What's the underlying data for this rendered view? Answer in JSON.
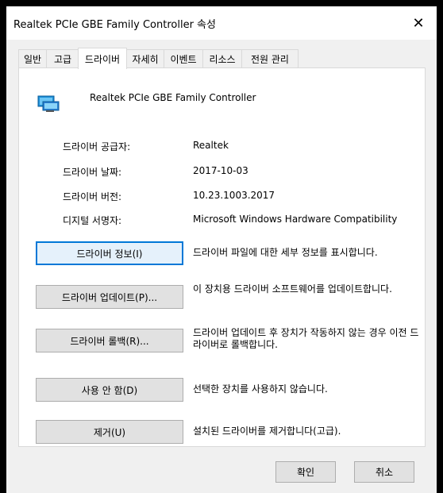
{
  "window": {
    "title": "Realtek PCIe GBE Family Controller 속성",
    "close_label": "✕"
  },
  "tabs": [
    "일반",
    "고급",
    "드라이버",
    "자세히",
    "이벤트",
    "리소스",
    "전원 관리"
  ],
  "active_tab": "드라이버",
  "device": {
    "name": "Realtek PCIe GBE Family Controller",
    "icon": "network-adapter-icon"
  },
  "info": [
    {
      "label": "드라이버 공급자:",
      "value": "Realtek"
    },
    {
      "label": "드라이버 날짜:",
      "value": "2017-10-03"
    },
    {
      "label": "드라이버 버전:",
      "value": "10.23.1003.2017"
    },
    {
      "label": "디지털 서명자:",
      "value": "Microsoft Windows Hardware Compatibility"
    }
  ],
  "actions": [
    {
      "button": "드라이버 정보(I)",
      "description": "드라이버 파일에 대한 세부 정보를 표시합니다."
    },
    {
      "button": "드라이버 업데이트(P)...",
      "description": "이 장치용 드라이버 소프트웨어를 업데이트합니다."
    },
    {
      "button": "드라이버 롤백(R)...",
      "description": "드라이버 업데이트 후 장치가 작동하지 않는 경우 이전 드라이버로 롤백합니다."
    },
    {
      "button": "사용 안 함(D)",
      "description": "선택한 장치를 사용하지 않습니다."
    },
    {
      "button": "제거(U)",
      "description": "설치된 드라이버를 제거합니다(고급)."
    }
  ],
  "footer": {
    "ok": "확인",
    "cancel": "취소"
  }
}
